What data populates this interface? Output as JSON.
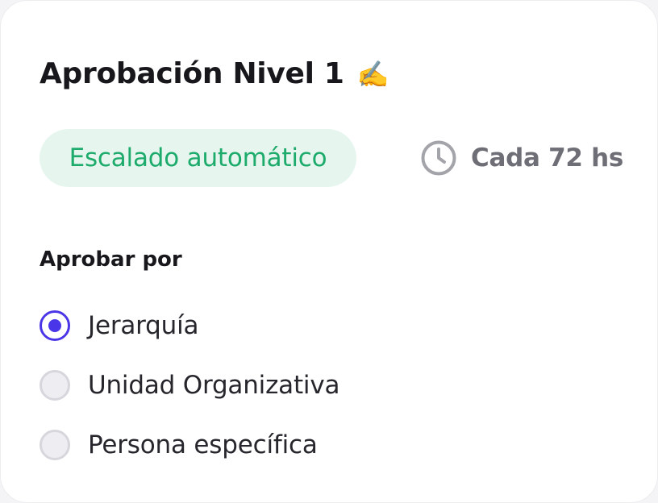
{
  "card": {
    "title": "Aprobación Nivel 1",
    "title_emoji": "✍️"
  },
  "escalation": {
    "badge_label": "Escalado automático",
    "interval_icon": "clock-icon",
    "interval_label": "Cada 72 hs"
  },
  "approve_by": {
    "label": "Aprobar por",
    "selected": "Jerarquía",
    "options": [
      {
        "label": "Jerarquía",
        "checked": true
      },
      {
        "label": "Unidad Organizativa",
        "checked": false
      },
      {
        "label": "Persona específica",
        "checked": false
      }
    ]
  },
  "colors": {
    "accent": "#4a36e8",
    "success_text": "#1dab6b",
    "success_bg": "#e6f6ef",
    "muted_text": "#6e6e76"
  }
}
